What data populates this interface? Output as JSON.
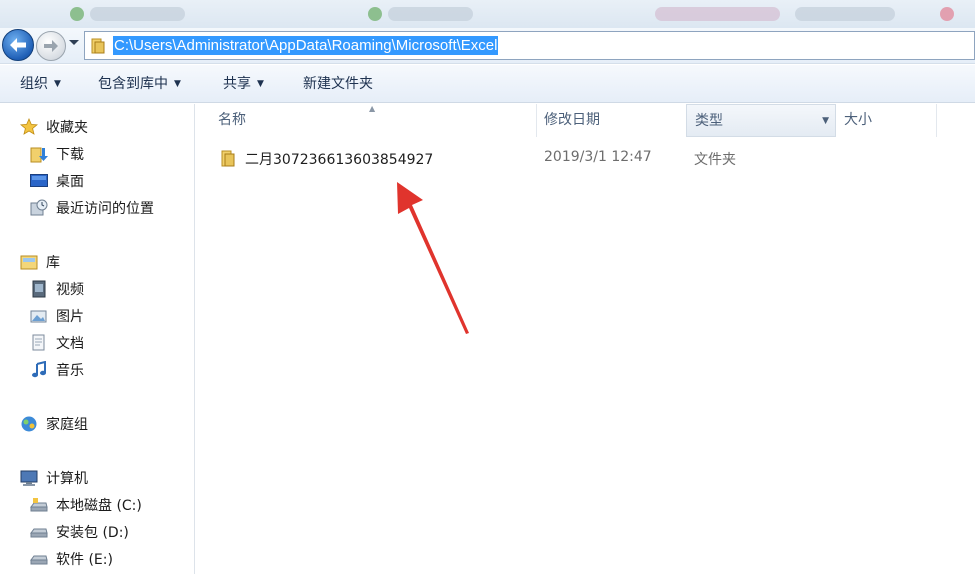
{
  "address_bar": {
    "path": "C:\\Users\\Administrator\\AppData\\Roaming\\Microsoft\\Excel"
  },
  "toolbar": {
    "organize": "组织",
    "include_in_library": "包含到库中",
    "share": "共享",
    "new_folder": "新建文件夹"
  },
  "nav": {
    "favorites": {
      "label": "收藏夹",
      "items": [
        "下载",
        "桌面",
        "最近访问的位置"
      ]
    },
    "libraries": {
      "label": "库",
      "items": [
        "视频",
        "图片",
        "文档",
        "音乐"
      ]
    },
    "homegroup": {
      "label": "家庭组"
    },
    "computer": {
      "label": "计算机",
      "items": [
        "本地磁盘 (C:)",
        "安装包 (D:)",
        "软件 (E:)"
      ]
    }
  },
  "columns": {
    "name": "名称",
    "modified": "修改日期",
    "type": "类型",
    "size": "大小"
  },
  "files": [
    {
      "name": "二月307236613603854927",
      "modified": "2019/3/1 12:47",
      "type": "文件夹"
    }
  ],
  "colors": {
    "selection": "#3399ff",
    "annotation_arrow": "#e0342d",
    "folder": "#e8c45a"
  }
}
